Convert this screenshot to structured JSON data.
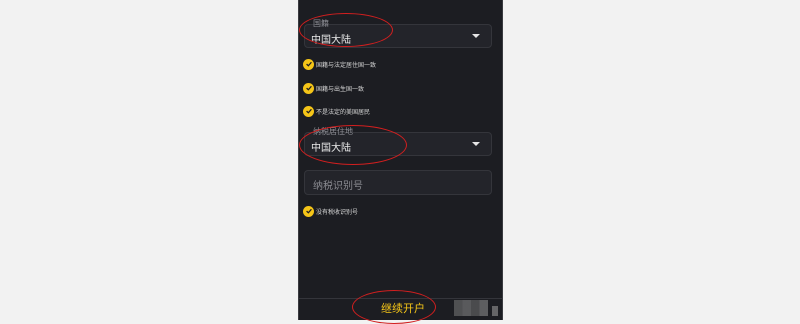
{
  "nationality": {
    "label": "国籍",
    "value": "中国大陆"
  },
  "checks": [
    {
      "text": "国籍与法定居住国一致"
    },
    {
      "text": "国籍与出生国一致"
    },
    {
      "text": "不是法定的美国居民"
    }
  ],
  "tax_residence": {
    "label": "纳税居住地",
    "value": "中国大陆"
  },
  "tax_id": {
    "placeholder": "纳税识别号"
  },
  "no_tax_id": {
    "text": "没有税收识别号"
  },
  "continue_button": {
    "label": "继续开户"
  },
  "colors": {
    "accent": "#f5c518",
    "background": "#1c1d22",
    "annotation": "#d21f1f"
  }
}
